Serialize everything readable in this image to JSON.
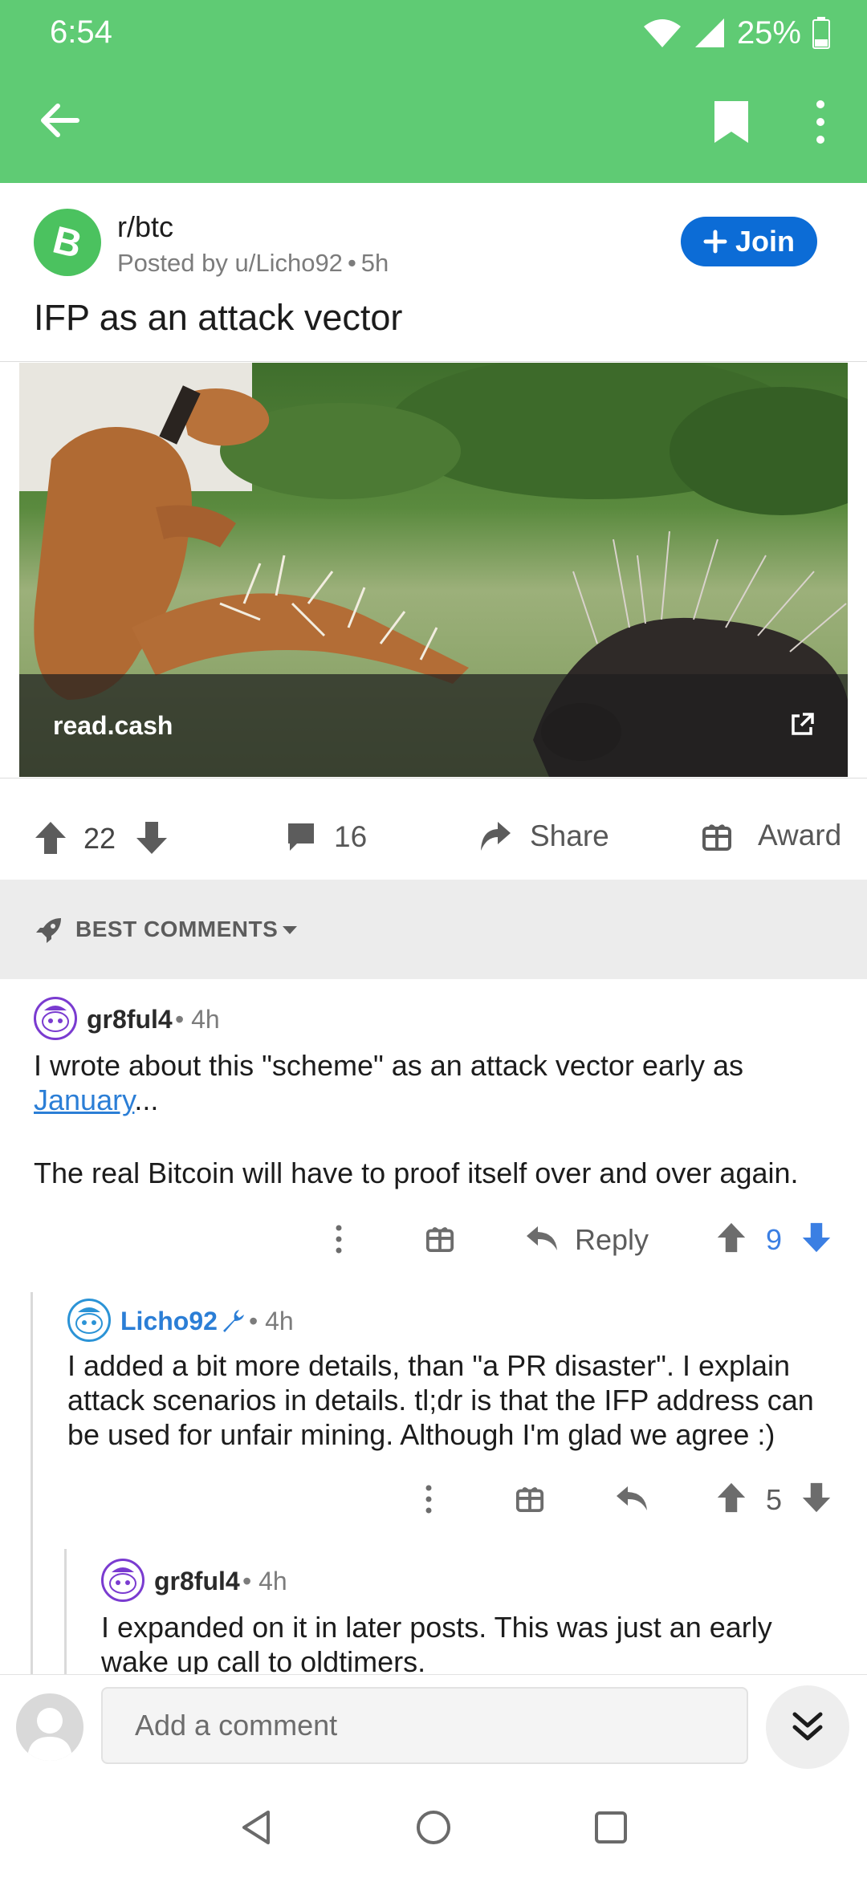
{
  "status": {
    "time": "6:54",
    "battery": "25%"
  },
  "app_bar": {
    "back_icon": "arrow-left-icon",
    "save_icon": "bookmark-icon",
    "more_icon": "more-vertical-icon"
  },
  "post": {
    "subreddit": "r/btc",
    "posted_by": "Posted by u/Licho92",
    "age": "5h",
    "join_label": "Join",
    "title": "IFP as an attack vector",
    "link_domain": "read.cash",
    "votes": "22",
    "comments": "16",
    "share_label": "Share",
    "award_label": "Award"
  },
  "sort": {
    "label": "BEST COMMENTS"
  },
  "comments": [
    {
      "author": "gr8ful4",
      "age": "4h",
      "body_pre": "I wrote about this \"scheme\" as an attack vector early as ",
      "body_link": "January",
      "body_post": "...",
      "body_p2": "The real Bitcoin will have to proof itself over and over again.",
      "reply_label": "Reply",
      "votes": "9"
    },
    {
      "author": "Licho92",
      "age": "4h",
      "body": "I added a bit more details, than \"a PR disaster\". I explain attack scenarios in details. tl;dr is that the IFP address can be used for unfair mining. Although I'm glad we agree :)",
      "votes": "5"
    },
    {
      "author": "gr8ful4",
      "age": "4h",
      "body": "I expanded on it in later posts. This was just an early wake up call to oldtimers."
    }
  ],
  "composer": {
    "placeholder": "Add a comment"
  },
  "colors": {
    "header": "#5fcb74",
    "join": "#0c6cd6",
    "upvoted": "#3b7fe3",
    "link": "#2b7ed6"
  }
}
